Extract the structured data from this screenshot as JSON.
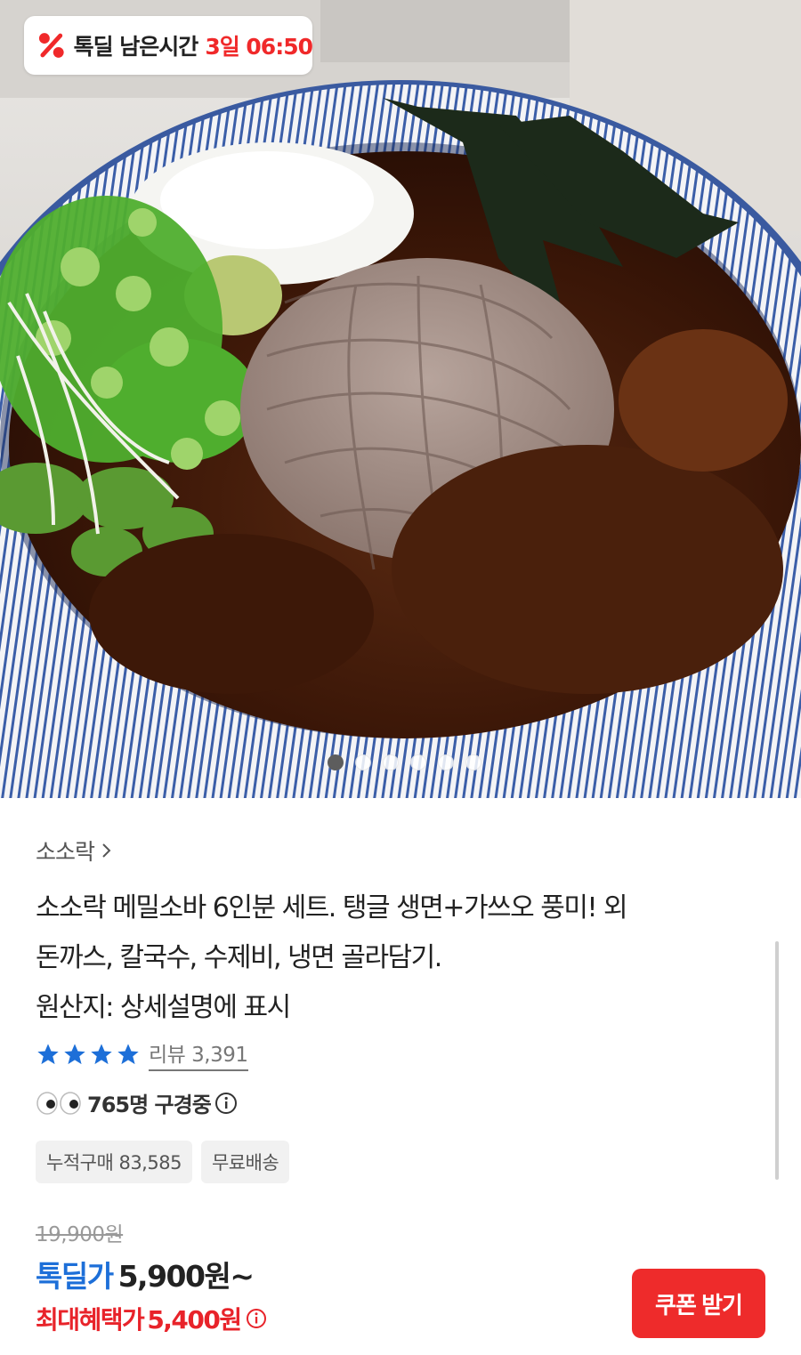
{
  "hero": {
    "image_alt": "메밀소바",
    "badge": {
      "icon": "percent-icon",
      "label": "톡딜 남은시간",
      "remaining": "3일 06:50"
    },
    "carousel": {
      "total": 6,
      "active": 1
    }
  },
  "product": {
    "seller": "소소락",
    "title": "소소락 메밀소바 6인분 세트. 탱글 생면+가쓰오 풍미! 외\n돈까스, 칼국수, 수제비, 냉면 골라담기.\n원산지: 상세설명에 표시",
    "rating": {
      "stars": 4,
      "review_label": "리뷰",
      "review_count": "3,391"
    },
    "viewing": {
      "icon": "eyes-icon",
      "text": "765명 구경중"
    },
    "tags": [
      "누적구매 83,585",
      "무료배송"
    ]
  },
  "price": {
    "original": "19,900원",
    "deal_label": "톡딜가",
    "deal_price": "5,900원~",
    "benefit_label": "최대혜택가",
    "benefit_price": "5,400원"
  },
  "actions": {
    "coupon_label": "쿠폰 받기"
  },
  "colors": {
    "accent_red": "#ee2b2b",
    "deal_blue": "#1d6fd8",
    "star_blue": "#1d6fd8"
  }
}
